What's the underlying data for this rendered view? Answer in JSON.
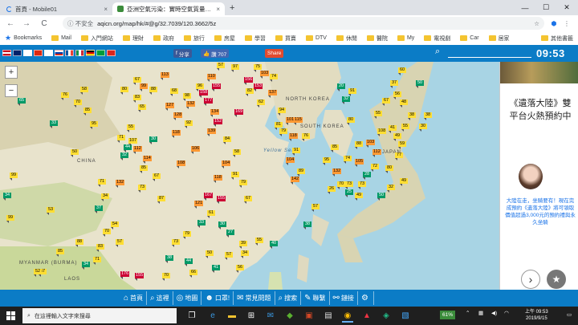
{
  "tabs": [
    {
      "title": "首頁 - Mobile01",
      "close": "×"
    },
    {
      "title": "亞洲空氣污染：實時空氣質量指數地圖",
      "close": "×"
    }
  ],
  "newtab": "+",
  "window_controls": {
    "minimize": "—",
    "maximize": "☐",
    "close": "✕"
  },
  "toolbar": {
    "back": "←",
    "forward": "→",
    "reload": "C",
    "insecure": "ⓘ 不安全",
    "url": "aqicn.org/map/hk/#@g/32.7039/120.3662/5z"
  },
  "bookmarks": [
    "Bookmarks",
    "Mail",
    "入門網站",
    "理財",
    "政府",
    "旅行",
    "房屋",
    "學習",
    "買賣",
    "DTV",
    "休閒",
    "醫院",
    "My",
    "電視劇",
    "Car",
    "居家",
    "其他書籤"
  ],
  "site": {
    "fb_share": "分享",
    "fb_like": "讚 707",
    "share": "Share",
    "clock": "09:53"
  },
  "map": {
    "labels": [
      "CHINA",
      "NORTH KOREA",
      "SOUTH KOREA",
      "Yellow Sea",
      "JAPAN",
      "MYANMAR (BURMA)",
      "LAOS"
    ],
    "zoom_in": "+",
    "zoom_out": "−",
    "markers": [
      [
        "g",
        "65",
        22,
        122
      ],
      [
        "y",
        "99",
        12,
        215
      ],
      [
        "g",
        "34",
        4,
        240
      ],
      [
        "y",
        "99",
        8,
        268
      ],
      [
        "y",
        "53",
        58,
        258
      ],
      [
        "y",
        "85",
        70,
        310
      ],
      [
        "y",
        "57",
        48,
        335
      ],
      [
        "y",
        "88",
        94,
        298
      ],
      [
        "y",
        "54",
        138,
        276
      ],
      [
        "g",
        "33",
        62,
        150
      ],
      [
        "y",
        "85",
        104,
        134
      ],
      [
        "y",
        "58",
        100,
        108
      ],
      [
        "y",
        "70",
        92,
        124
      ],
      [
        "y",
        "95",
        112,
        151
      ],
      [
        "y",
        "76",
        76,
        115
      ],
      [
        "y",
        "50",
        88,
        186
      ],
      [
        "y",
        "71",
        122,
        223
      ],
      [
        "y",
        "34",
        126,
        241
      ],
      [
        "g",
        "37",
        118,
        256
      ],
      [
        "y",
        "70",
        128,
        285
      ],
      [
        "y",
        "71",
        116,
        320
      ],
      [
        "y",
        "83",
        120,
        304
      ],
      [
        "g",
        "34",
        102,
        326
      ],
      [
        "y",
        "57",
        144,
        298
      ],
      [
        "y",
        "52",
        42,
        335
      ],
      [
        "y",
        "67",
        166,
        96
      ],
      [
        "o",
        "99",
        174,
        104
      ],
      [
        "y",
        "80",
        150,
        108
      ],
      [
        "y",
        "83",
        166,
        118
      ],
      [
        "y",
        "65",
        172,
        130
      ],
      [
        "y",
        "55",
        158,
        155
      ],
      [
        "y",
        "71",
        146,
        168
      ],
      [
        "g",
        "44",
        154,
        180
      ],
      [
        "y",
        "107",
        160,
        172
      ],
      [
        "o",
        "112",
        166,
        182
      ],
      [
        "o",
        "114",
        178,
        194
      ],
      [
        "o",
        "132",
        144,
        224
      ],
      [
        "g",
        "32",
        150,
        190
      ],
      [
        "y",
        "85",
        174,
        206
      ],
      [
        "y",
        "67",
        190,
        216
      ],
      [
        "y",
        "73",
        172,
        230
      ],
      [
        "y",
        "87",
        196,
        244
      ],
      [
        "o",
        "108",
        220,
        200
      ],
      [
        "o",
        "118",
        214,
        162
      ],
      [
        "o",
        "127",
        206,
        128
      ],
      [
        "o",
        "128",
        216,
        140
      ],
      [
        "y",
        "88",
        186,
        108
      ],
      [
        "o",
        "113",
        200,
        90
      ],
      [
        "o",
        "132",
        232,
        126
      ],
      [
        "y",
        "98",
        228,
        116
      ],
      [
        "y",
        "92",
        230,
        150
      ],
      [
        "g",
        "30",
        186,
        170
      ],
      [
        "o",
        "106",
        238,
        182
      ],
      [
        "o",
        "134",
        262,
        136
      ],
      [
        "y",
        "96",
        244,
        104
      ],
      [
        "o",
        "110",
        258,
        92
      ],
      [
        "y",
        "68",
        212,
        110
      ],
      [
        "r",
        "158",
        248,
        112
      ],
      [
        "r",
        "177",
        254,
        122
      ],
      [
        "r",
        "155",
        264,
        104
      ],
      [
        "r",
        "152",
        266,
        148
      ],
      [
        "r",
        "167",
        254,
        240
      ],
      [
        "r",
        "155",
        270,
        244
      ],
      [
        "r",
        "176",
        150,
        338
      ],
      [
        "r",
        "155",
        168,
        340
      ],
      [
        "r",
        "169",
        292,
        136
      ],
      [
        "r",
        "156",
        304,
        96
      ],
      [
        "r",
        "153",
        316,
        104
      ],
      [
        "o",
        "139",
        258,
        160
      ],
      [
        "y",
        "84",
        278,
        170
      ],
      [
        "y",
        "58",
        290,
        186
      ],
      [
        "o",
        "104",
        276,
        200
      ],
      [
        "y",
        "91",
        288,
        214
      ],
      [
        "o",
        "118",
        266,
        218
      ],
      [
        "y",
        "79",
        298,
        224
      ],
      [
        "y",
        "67",
        304,
        244
      ],
      [
        "o",
        "121",
        242,
        250
      ],
      [
        "y",
        "61",
        258,
        262
      ],
      [
        "g",
        "30",
        272,
        276
      ],
      [
        "g",
        "33",
        246,
        274
      ],
      [
        "g",
        "27",
        282,
        286
      ],
      [
        "y",
        "39",
        298,
        300
      ],
      [
        "y",
        "55",
        318,
        296
      ],
      [
        "y",
        "79",
        228,
        288
      ],
      [
        "y",
        "73",
        214,
        298
      ],
      [
        "g",
        "38",
        206,
        318
      ],
      [
        "g",
        "44",
        230,
        322
      ],
      [
        "y",
        "50",
        256,
        312
      ],
      [
        "g",
        "41",
        264,
        330
      ],
      [
        "y",
        "56",
        294,
        330
      ],
      [
        "y",
        "57",
        280,
        314
      ],
      [
        "y",
        "66",
        236,
        336
      ],
      [
        "y",
        "70",
        202,
        340
      ],
      [
        "y",
        "34",
        300,
        312
      ],
      [
        "g",
        "40",
        336,
        300
      ],
      [
        "o",
        "103",
        324,
        88
      ],
      [
        "y",
        "57",
        270,
        78
      ],
      [
        "y",
        "97",
        288,
        80
      ],
      [
        "y",
        "75",
        316,
        80
      ],
      [
        "y",
        "74",
        336,
        92
      ],
      [
        "y",
        "82",
        306,
        110
      ],
      [
        "y",
        "62",
        320,
        124
      ],
      [
        "o",
        "137",
        334,
        112
      ],
      [
        "y",
        "94",
        346,
        134
      ],
      [
        "o",
        "101",
        356,
        146
      ],
      [
        "y",
        "81",
        342,
        152
      ],
      [
        "y",
        "79",
        348,
        160
      ],
      [
        "o",
        "118",
        360,
        166
      ],
      [
        "o",
        "115",
        366,
        146
      ],
      [
        "y",
        "91",
        364,
        184
      ],
      [
        "o",
        "104",
        356,
        196
      ],
      [
        "y",
        "89",
        370,
        210
      ],
      [
        "o",
        "142",
        362,
        220
      ],
      [
        "y",
        "76",
        376,
        166
      ],
      [
        "g",
        "20",
        420,
        104
      ],
      [
        "g",
        "32",
        426,
        120
      ],
      [
        "y",
        "91",
        434,
        110
      ],
      [
        "y",
        "80",
        432,
        146
      ],
      [
        "y",
        "88",
        442,
        176
      ],
      [
        "o",
        "103",
        456,
        174
      ],
      [
        "o",
        "112",
        464,
        186
      ],
      [
        "y",
        "108",
        470,
        160
      ],
      [
        "y",
        "41",
        484,
        156
      ],
      [
        "y",
        "49",
        490,
        166
      ],
      [
        "o",
        "105",
        442,
        198
      ],
      [
        "o",
        "132",
        414,
        210
      ],
      [
        "y",
        "74",
        428,
        194
      ],
      [
        "y",
        "95",
        402,
        196
      ],
      [
        "y",
        "85",
        412,
        180
      ],
      [
        "y",
        "70",
        420,
        226
      ],
      [
        "y",
        "26",
        408,
        232
      ],
      [
        "y",
        "73",
        430,
        226
      ],
      [
        "g",
        "28",
        452,
        214
      ],
      [
        "y",
        "73",
        446,
        226
      ],
      [
        "y",
        "72",
        462,
        204
      ],
      [
        "y",
        "80",
        480,
        206
      ],
      [
        "y",
        "77",
        492,
        190
      ],
      [
        "y",
        "59",
        496,
        176
      ],
      [
        "y",
        "55",
        500,
        154
      ],
      [
        "y",
        "38",
        508,
        140
      ],
      [
        "y",
        "30",
        522,
        154
      ],
      [
        "y",
        "38",
        528,
        140
      ],
      [
        "y",
        "37",
        486,
        100
      ],
      [
        "y",
        "60",
        496,
        84
      ],
      [
        "y",
        "56",
        490,
        114
      ],
      [
        "y",
        "48",
        498,
        124
      ],
      [
        "g",
        "50",
        518,
        100
      ],
      [
        "y",
        "67",
        476,
        122
      ],
      [
        "y",
        "55",
        466,
        138
      ],
      [
        "g",
        "25",
        430,
        236
      ],
      [
        "y",
        "49",
        442,
        240
      ],
      [
        "g",
        "50",
        470,
        240
      ],
      [
        "y",
        "32",
        482,
        230
      ],
      [
        "y",
        "49",
        498,
        222
      ],
      [
        "y",
        "57",
        388,
        254
      ],
      [
        "g",
        "38",
        378,
        276
      ]
    ]
  },
  "ad": {
    "title": "《遺落大陸》雙平台火熱預約中",
    "body": "大陸在走，坐騎要有！現在完成預約《遺落大陸》將可領取價值超過3,000元的預約禮與永久坐騎",
    "next": "›",
    "star": "★"
  },
  "bottom_nav": [
    {
      "icon": "⌂",
      "label": "首頁"
    },
    {
      "icon": "⌕",
      "label": "這裡"
    },
    {
      "icon": "◎",
      "label": "地圖"
    },
    {
      "icon": "☻",
      "label": "口罩!"
    },
    {
      "icon": "✉",
      "label": "常見問題"
    },
    {
      "icon": "⌕",
      "label": "搜索"
    },
    {
      "icon": "✎",
      "label": "聯繫"
    },
    {
      "icon": "⚯",
      "label": "鏈接"
    },
    {
      "icon": "⚙",
      "label": ""
    }
  ],
  "taskbar": {
    "search_placeholder": "在這裡輸入文字來搜尋",
    "battery": "61%",
    "time": "上午 09:53",
    "date": "2019/9/15"
  }
}
